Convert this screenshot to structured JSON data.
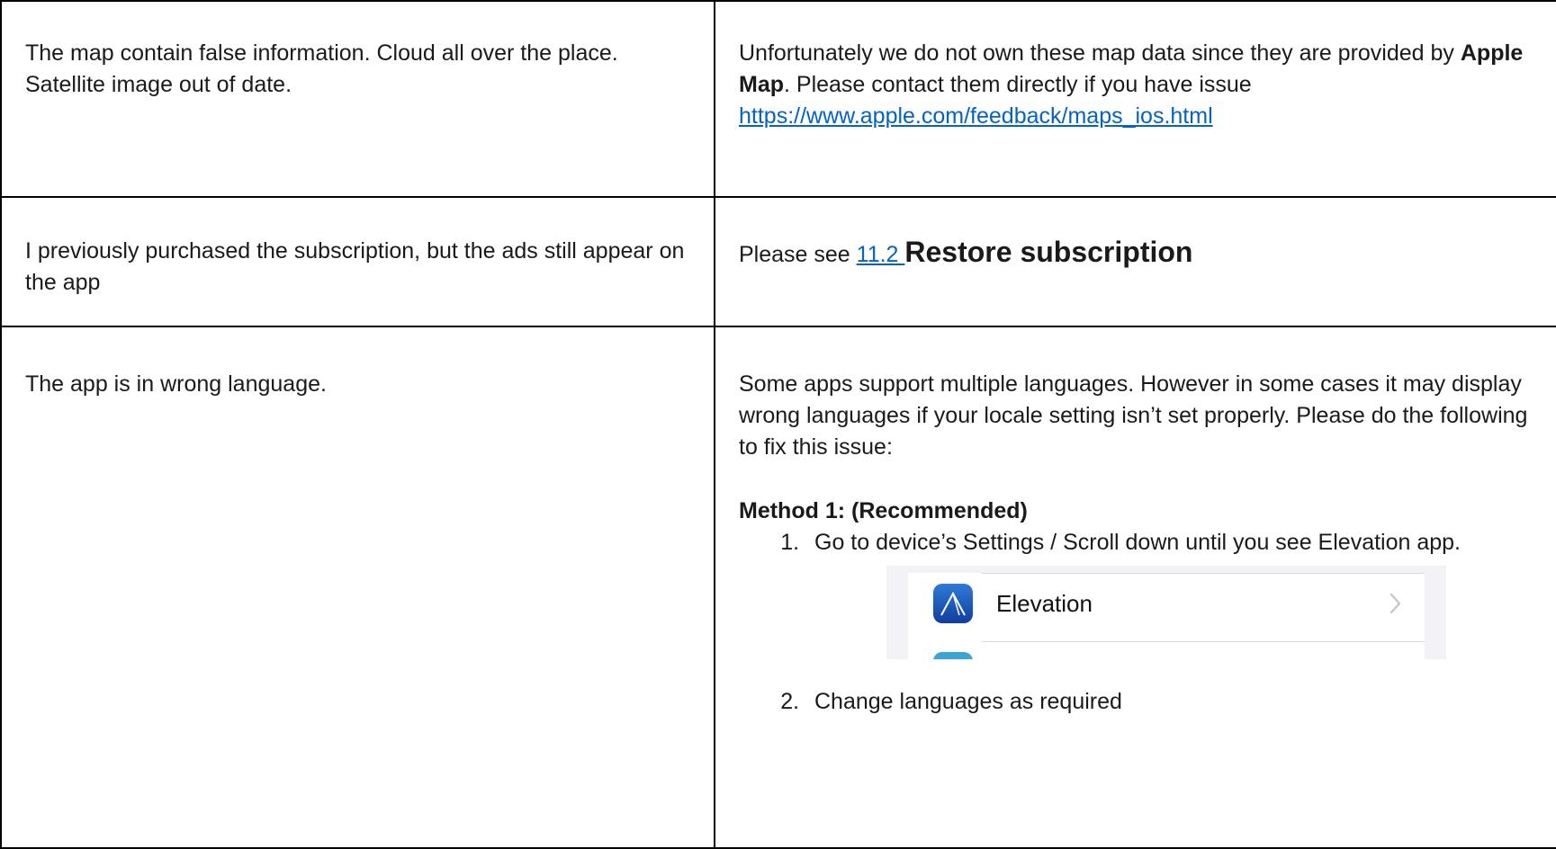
{
  "rows": [
    {
      "question": "The map contain false information. Cloud all over the place. Satellite image out of date.",
      "answer_intro": "Unfortunately we do not own these map data since they are provided by ",
      "answer_bold": "Apple Map",
      "answer_rest": ". Please contact them directly if you have issue",
      "answer_link": "https://www.apple.com/feedback/maps_ios.html"
    },
    {
      "question": "I previously purchased the subscription, but the ads still appear on the app",
      "answer_prefix": "Please see ",
      "answer_link_number": "11.2 ",
      "answer_link_title": "Restore subscription"
    },
    {
      "question": "The app is in wrong language.",
      "answer_intro": "Some apps support multiple languages. However in some cases it may display wrong languages if your locale setting isn’t set properly. Please do the following to fix this issue:",
      "method_heading": "Method 1: (Recommended)",
      "steps": [
        "Go to device’s Settings / Scroll down until you see Elevation app.",
        "Change languages as required"
      ],
      "settings_screenshot": {
        "app_name": "Elevation",
        "app_icon": "elevation-app-icon",
        "chevron_icon": "chevron-right-icon"
      }
    }
  ]
}
